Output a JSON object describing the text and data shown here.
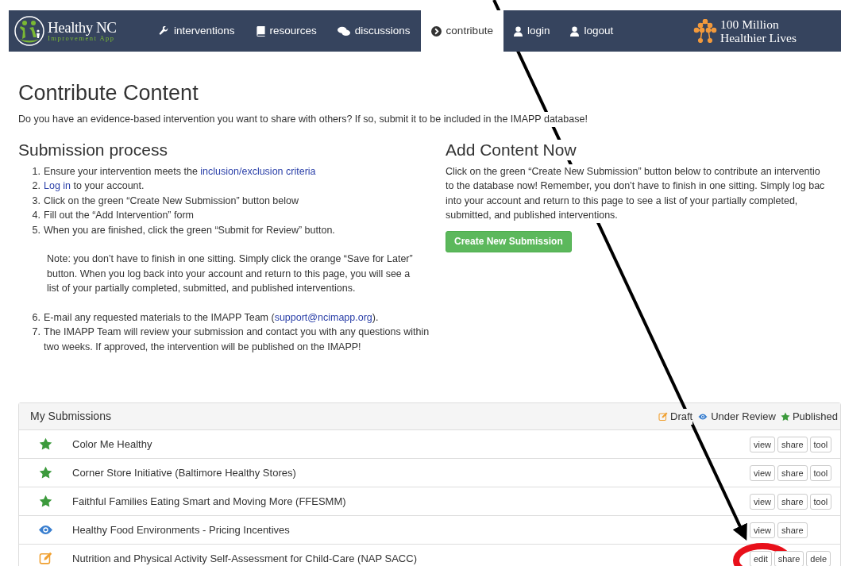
{
  "navbar": {
    "logo": {
      "title": "Healthy NC",
      "subtitle": "Improvement App"
    },
    "items": [
      {
        "label": "interventions",
        "kind": "wrench",
        "selected": false
      },
      {
        "label": "resources",
        "kind": "book",
        "selected": false
      },
      {
        "label": "discussions",
        "kind": "comments",
        "selected": false
      },
      {
        "label": "contribute",
        "kind": "chevron",
        "selected": true
      },
      {
        "label": "login",
        "kind": "user",
        "selected": false
      },
      {
        "label": "logout",
        "kind": "user",
        "selected": false
      }
    ],
    "partner": {
      "line1": "100 Million",
      "line2": "Healthier Lives"
    }
  },
  "title": "Contribute Content",
  "intro": "Do you have an evidence-based intervention you want to share with others? If so, submit it to be included in the IMAPP database!",
  "process": {
    "heading": "Submission process",
    "steps": [
      {
        "number": "1.",
        "parts": [
          {
            "text": "Ensure your intervention meets the ",
            "link": false
          },
          {
            "text": "inclusion/exclusion criteria",
            "link": true
          }
        ]
      },
      {
        "number": "2.",
        "parts": [
          {
            "text": "Log in",
            "link": true
          },
          {
            "text": " to your account.",
            "link": false
          }
        ]
      },
      {
        "number": "3.",
        "parts": [
          {
            "text": "Click on the green “Create New Submission” button below",
            "link": false
          }
        ]
      },
      {
        "number": "4.",
        "parts": [
          {
            "text": "Fill out the “Add Intervention” form",
            "link": false
          }
        ]
      },
      {
        "number": "5.",
        "parts": [
          {
            "text": "When you are finished, click the green “Submit for Review” button.",
            "link": false
          }
        ]
      }
    ],
    "note": "Note: you don’t have to finish in one sitting. Simply click the orange “Save for Later” button. When you log back into your account and return to this page, you will see a list of your partially completed, submitted, and published interventions.",
    "steps_after": [
      {
        "number": "6.",
        "parts": [
          {
            "text": "E-mail any requested materials to the IMAPP Team (",
            "link": false
          },
          {
            "text": "support@ncimapp.org",
            "link": true
          },
          {
            "text": ").",
            "link": false
          }
        ]
      },
      {
        "number": "7.",
        "parts": [
          {
            "text": "The IMAPP Team will review your submission and contact you with any questions within two weeks. If approved, the intervention will be published on the IMAPP!",
            "link": false
          }
        ]
      }
    ]
  },
  "add_content": {
    "heading": "Add Content Now",
    "lines": [
      "Click on the green “Create New Submission” button below to contribute an interventio",
      "to the database now! Remember, you don’t have to finish in one sitting. Simply log bac",
      "into your account and return to this page to see a list of your partially completed,",
      "submitted, and published interventions."
    ],
    "button": "Create New Submission"
  },
  "submissions": {
    "title": "My Submissions",
    "legend": [
      {
        "kind": "draft",
        "label": "Draft"
      },
      {
        "kind": "review",
        "label": "Under Review"
      },
      {
        "kind": "published",
        "label": "Published"
      }
    ],
    "rows": [
      {
        "kind": "published",
        "name": "Color Me Healthy",
        "actions": [
          "view",
          "share",
          "tool"
        ]
      },
      {
        "kind": "published",
        "name": "Corner Store Initiative (Baltimore Healthy Stores)",
        "actions": [
          "view",
          "share",
          "tool"
        ]
      },
      {
        "kind": "published",
        "name": "Faithful Families Eating Smart and Moving More (FFESMM)",
        "actions": [
          "view",
          "share",
          "tool"
        ]
      },
      {
        "kind": "review",
        "name": "Healthy Food Environments - Pricing Incentives",
        "actions": [
          "view",
          "share"
        ]
      },
      {
        "kind": "draft",
        "name": "Nutrition and Physical Activity Self-Assessment for Child-Care (NAP SACC)",
        "actions": [
          "edit",
          "share",
          "dele"
        ]
      }
    ]
  }
}
